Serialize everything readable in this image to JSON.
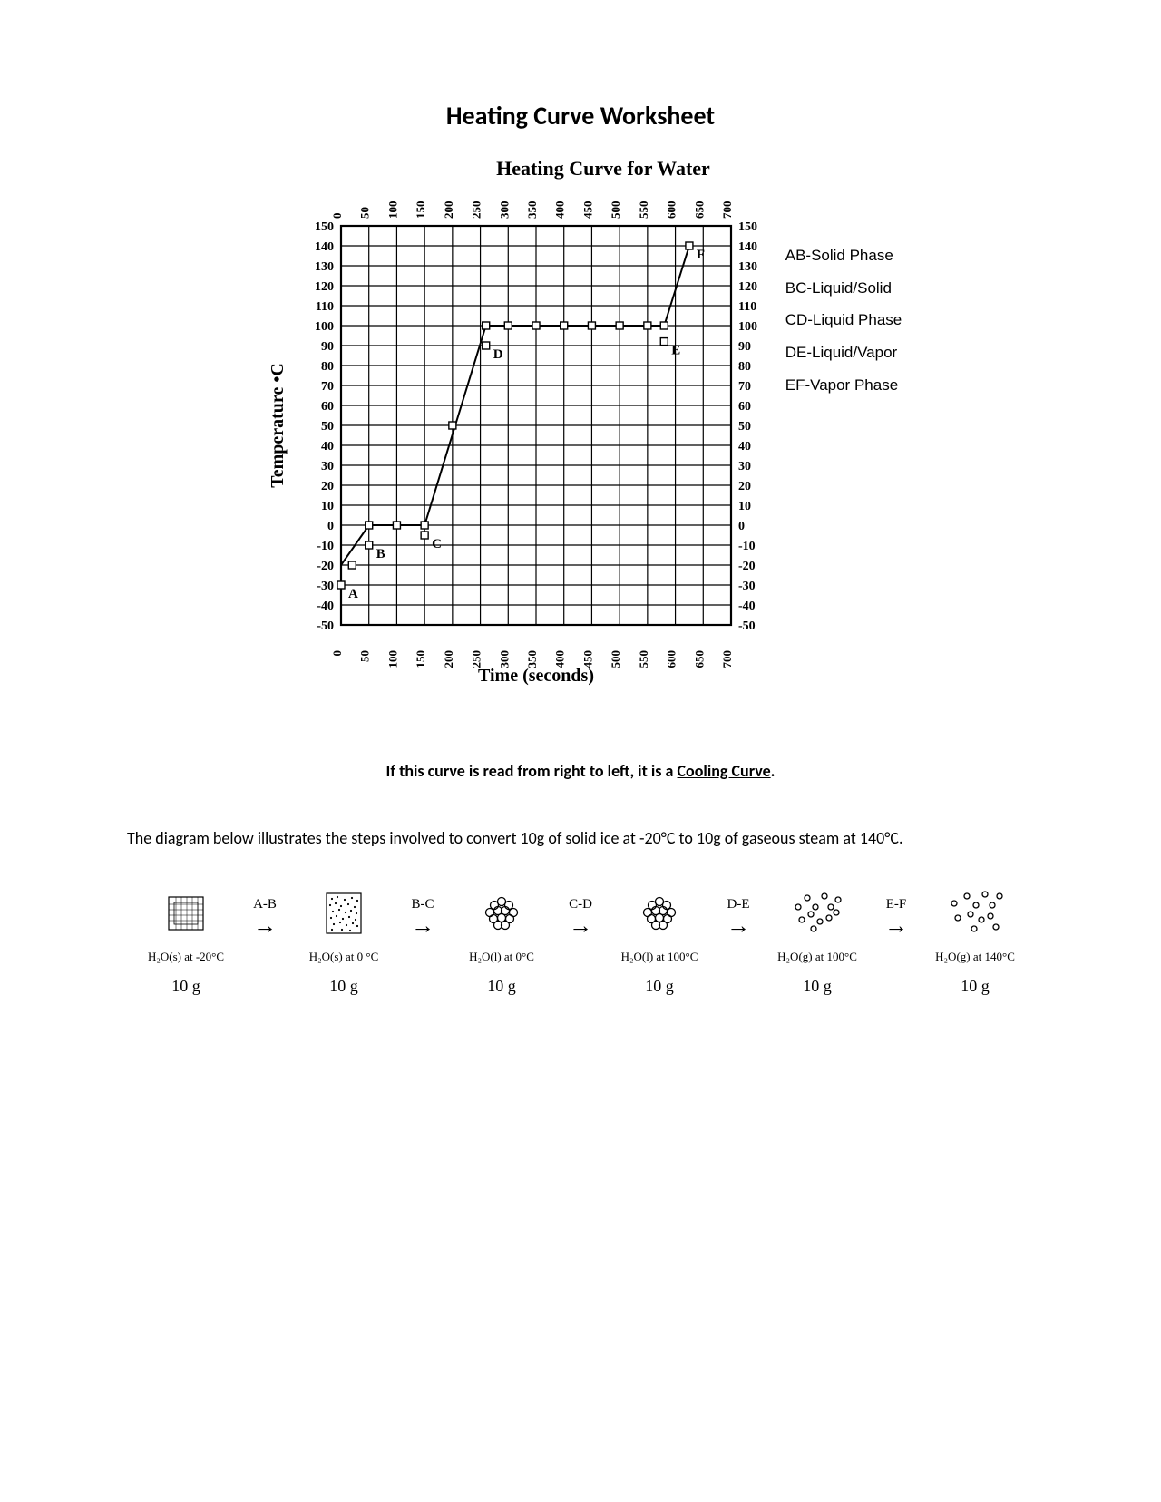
{
  "title": "Heating Curve Worksheet",
  "chart_title": "Heating Curve for Water",
  "y_axis_label": "Temperature •C",
  "x_axis_label": "Time (seconds)",
  "legend": {
    "ab": "AB-Solid Phase",
    "bc": "BC-Liquid/Solid",
    "cd": "CD-Liquid Phase",
    "de": "DE-Liquid/Vapor",
    "ef": "EF-Vapor Phase"
  },
  "note_prefix": "If this curve is read from right to left, it is a ",
  "note_underline": "Cooling Curve",
  "note_suffix": ".",
  "explain": "The diagram below illustrates the steps involved to convert 10g of solid ice at -20°C to 10g of gaseous steam at 140°C.",
  "phase": {
    "mass": "10 g",
    "arrows": {
      "ab": "A-B",
      "bc": "B-C",
      "cd": "C-D",
      "de": "D-E",
      "ef": "E-F"
    },
    "labels": {
      "s_neg20": "H₂O(s) at -20°C",
      "s_0": "H₂O(s) at 0 °C",
      "l_0": "H₂O(l) at 0°C",
      "l_100": "H₂O(l) at 100°C",
      "g_100": "H₂O(g) at 100°C",
      "g_140": "H₂O(g) at 140°C"
    }
  },
  "chart_data": {
    "type": "line",
    "xlabel": "Time (seconds)",
    "ylabel": "Temperature (°C)",
    "xlim": [
      0,
      700
    ],
    "ylim": [
      -50,
      150
    ],
    "x_ticks": [
      0,
      50,
      100,
      150,
      200,
      250,
      300,
      350,
      400,
      450,
      500,
      550,
      600,
      650,
      700
    ],
    "y_ticks": [
      -50,
      -40,
      -30,
      -20,
      -10,
      0,
      10,
      20,
      30,
      40,
      50,
      60,
      70,
      80,
      90,
      100,
      110,
      120,
      130,
      140,
      150
    ],
    "points": [
      {
        "label": "A",
        "x": 0,
        "y": -30
      },
      {
        "label": "",
        "x": 20,
        "y": -20
      },
      {
        "label": "B",
        "x": 50,
        "y": -10
      },
      {
        "label": "",
        "x": 50,
        "y": 0
      },
      {
        "label": "",
        "x": 100,
        "y": 0
      },
      {
        "label": "C",
        "x": 150,
        "y": -5
      },
      {
        "label": "",
        "x": 150,
        "y": 0
      },
      {
        "label": "",
        "x": 200,
        "y": 50
      },
      {
        "label": "D",
        "x": 260,
        "y": 90
      },
      {
        "label": "",
        "x": 260,
        "y": 100
      },
      {
        "label": "",
        "x": 300,
        "y": 100
      },
      {
        "label": "",
        "x": 350,
        "y": 100
      },
      {
        "label": "",
        "x": 400,
        "y": 100
      },
      {
        "label": "",
        "x": 450,
        "y": 100
      },
      {
        "label": "",
        "x": 500,
        "y": 100
      },
      {
        "label": "",
        "x": 550,
        "y": 100
      },
      {
        "label": "E",
        "x": 580,
        "y": 92
      },
      {
        "label": "",
        "x": 580,
        "y": 100
      },
      {
        "label": "F",
        "x": 625,
        "y": 140
      }
    ],
    "series_path": [
      {
        "x": 0,
        "y": -20
      },
      {
        "x": 50,
        "y": 0
      },
      {
        "x": 150,
        "y": 0
      },
      {
        "x": 260,
        "y": 100
      },
      {
        "x": 580,
        "y": 100
      },
      {
        "x": 625,
        "y": 140
      }
    ]
  }
}
